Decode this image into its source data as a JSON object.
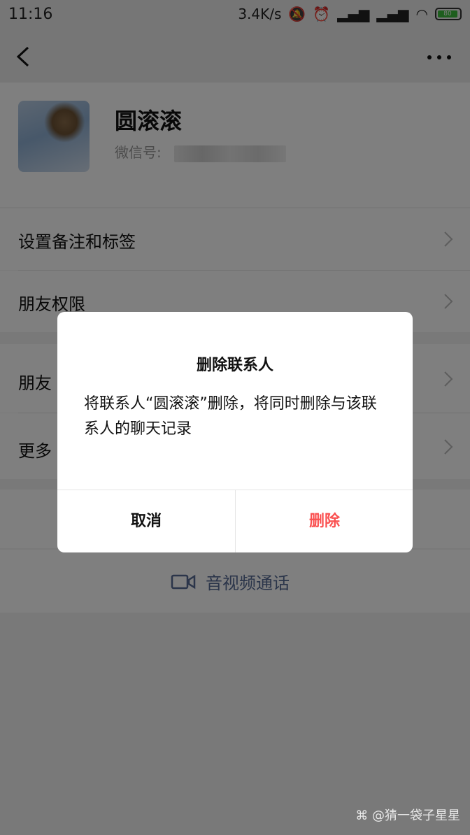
{
  "status_bar": {
    "time": "11:16",
    "speed": "3.4K/s",
    "battery": "80"
  },
  "profile": {
    "name": "圆滚滚",
    "wechat_id_label": "微信号: "
  },
  "menu": {
    "items": [
      {
        "label": "设置备注和标签"
      },
      {
        "label": "朋友权限"
      },
      {
        "label": "朋友"
      },
      {
        "label": "更多"
      }
    ],
    "video_call": "音视频通话"
  },
  "dialog": {
    "title": "删除联系人",
    "message": "将联系人“圆滚滚”删除，将同时删除与该联系人的聊天记录",
    "cancel_label": "取消",
    "delete_label": "删除"
  },
  "watermark": "⌘ @猜一袋子星星",
  "colors": {
    "accent_blue": "#576b95",
    "danger_red": "#fa5151",
    "battery_green": "#3cbc3c"
  }
}
